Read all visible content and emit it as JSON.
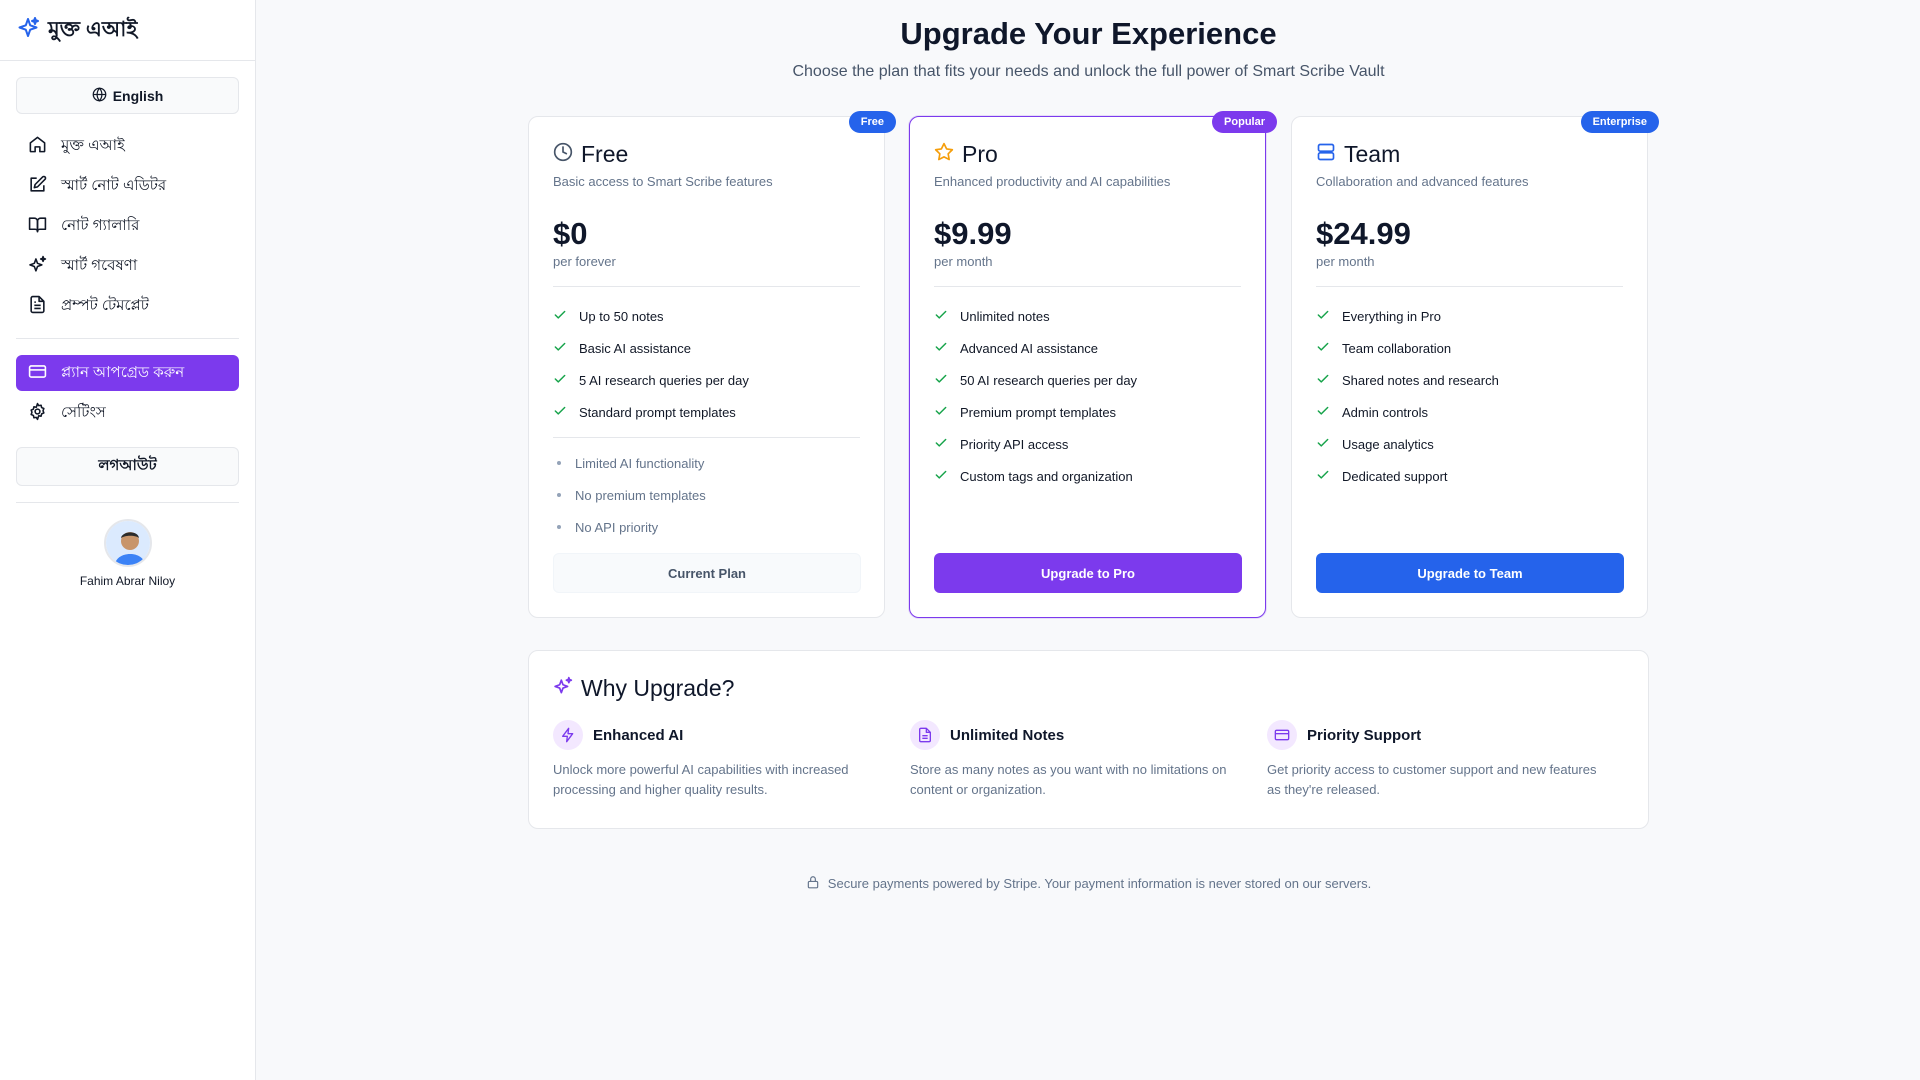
{
  "sidebar": {
    "brand": "মুক্ত এআই",
    "language": "English",
    "nav": [
      {
        "label": "মুক্ত এআই",
        "icon": "home-icon"
      },
      {
        "label": "স্মার্ট নোট এডিটর",
        "icon": "edit-icon"
      },
      {
        "label": "নোট গ্যালারি",
        "icon": "book-icon"
      },
      {
        "label": "স্মার্ট গবেষণা",
        "icon": "sparkles-icon"
      },
      {
        "label": "প্রম্পট টেমপ্লেট",
        "icon": "file-text-icon"
      }
    ],
    "upgrade": {
      "label": "প্ল্যান আপগ্রেড করুন",
      "icon": "credit-card-icon"
    },
    "settings": {
      "label": "সেটিংস",
      "icon": "gear-icon"
    },
    "logout": "লগআউট",
    "user_name": "Fahim Abrar Niloy"
  },
  "header": {
    "title": "Upgrade Your Experience",
    "subtitle": "Choose the plan that fits your needs and unlock the full power of Smart Scribe Vault"
  },
  "plans": [
    {
      "badge": "Free",
      "name": "Free",
      "description": "Basic access to Smart Scribe features",
      "price": "$0",
      "period": "per forever",
      "features": [
        "Up to 50 notes",
        "Basic AI assistance",
        "5 AI research queries per day",
        "Standard prompt templates"
      ],
      "limitations": [
        "Limited AI functionality",
        "No premium templates",
        "No API priority"
      ],
      "button": "Current Plan",
      "icon": "clock-icon"
    },
    {
      "badge": "Popular",
      "name": "Pro",
      "description": "Enhanced productivity and AI capabilities",
      "price": "$9.99",
      "period": "per month",
      "features": [
        "Unlimited notes",
        "Advanced AI assistance",
        "50 AI research queries per day",
        "Premium prompt templates",
        "Priority API access",
        "Custom tags and organization"
      ],
      "button": "Upgrade to Pro",
      "icon": "star-icon"
    },
    {
      "badge": "Enterprise",
      "name": "Team",
      "description": "Collaboration and advanced features",
      "price": "$24.99",
      "period": "per month",
      "features": [
        "Everything in Pro",
        "Team collaboration",
        "Shared notes and research",
        "Admin controls",
        "Usage analytics",
        "Dedicated support"
      ],
      "button": "Upgrade to Team",
      "icon": "server-icon"
    }
  ],
  "why": {
    "title": "Why Upgrade?",
    "items": [
      {
        "title": "Enhanced AI",
        "text": "Unlock more powerful AI capabilities with increased processing and higher quality results.",
        "icon": "lightning-icon"
      },
      {
        "title": "Unlimited Notes",
        "text": "Store as many notes as you want with no limitations on content or organization.",
        "icon": "document-icon"
      },
      {
        "title": "Priority Support",
        "text": "Get priority access to customer support and new features as they're released.",
        "icon": "credit-card-icon"
      }
    ]
  },
  "footer": {
    "secure": "Secure payments powered by Stripe. Your payment information is never stored on our servers.",
    "icon": "lock-icon"
  },
  "colors": {
    "accent_purple": "#7c3aed",
    "accent_blue": "#2563eb",
    "check_green": "#16a34a",
    "star_orange": "#f59e0b"
  }
}
